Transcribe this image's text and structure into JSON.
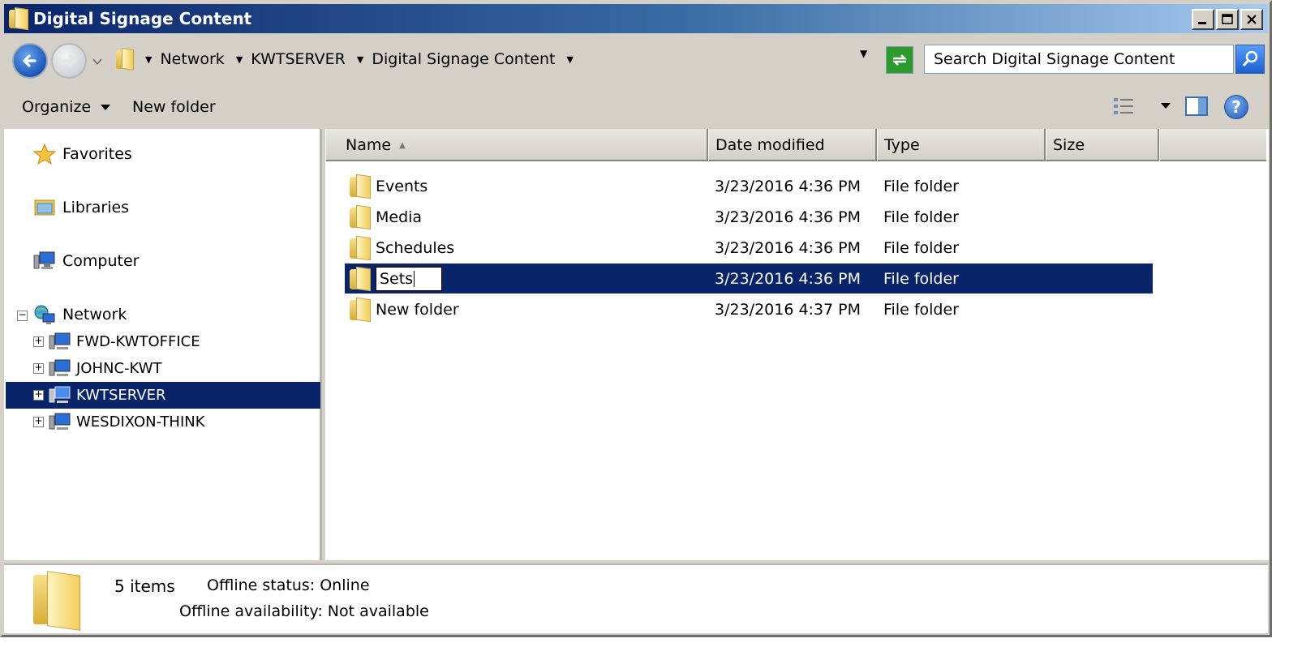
{
  "window": {
    "title": "Digital Signage Content"
  },
  "address": {
    "crumbs": [
      "Network",
      "KWTSERVER",
      "Digital Signage Content"
    ],
    "search_placeholder": "Search Digital Signage Content"
  },
  "toolbar": {
    "organize": "Organize",
    "new_folder": "New folder"
  },
  "nav": {
    "favorites": "Favorites",
    "libraries": "Libraries",
    "computer": "Computer",
    "network": "Network",
    "network_children": [
      "FWD-KWTOFFICE",
      "JOHNC-KWT",
      "KWTSERVER",
      "WESDIXON-THINK"
    ],
    "selected_child": "KWTSERVER"
  },
  "columns": {
    "name": "Name",
    "date": "Date modified",
    "type": "Type",
    "size": "Size"
  },
  "files": [
    {
      "name": "Events",
      "date": "3/23/2016 4:36 PM",
      "type": "File folder"
    },
    {
      "name": "Media",
      "date": "3/23/2016 4:36 PM",
      "type": "File folder"
    },
    {
      "name": "Schedules",
      "date": "3/23/2016 4:36 PM",
      "type": "File folder"
    },
    {
      "name": "Sets",
      "date": "3/23/2016 4:36 PM",
      "type": "File folder",
      "renaming": true
    },
    {
      "name": "New folder",
      "date": "3/23/2016 4:37 PM",
      "type": "File folder"
    }
  ],
  "details": {
    "count": "5 items",
    "offline_status_label": "Offline status:",
    "offline_status_value": "Online",
    "offline_availability_label": "Offline availability:",
    "offline_availability_value": "Not available"
  },
  "colors": {
    "selection": "#0a246a",
    "chrome": "#d4d0c8"
  }
}
